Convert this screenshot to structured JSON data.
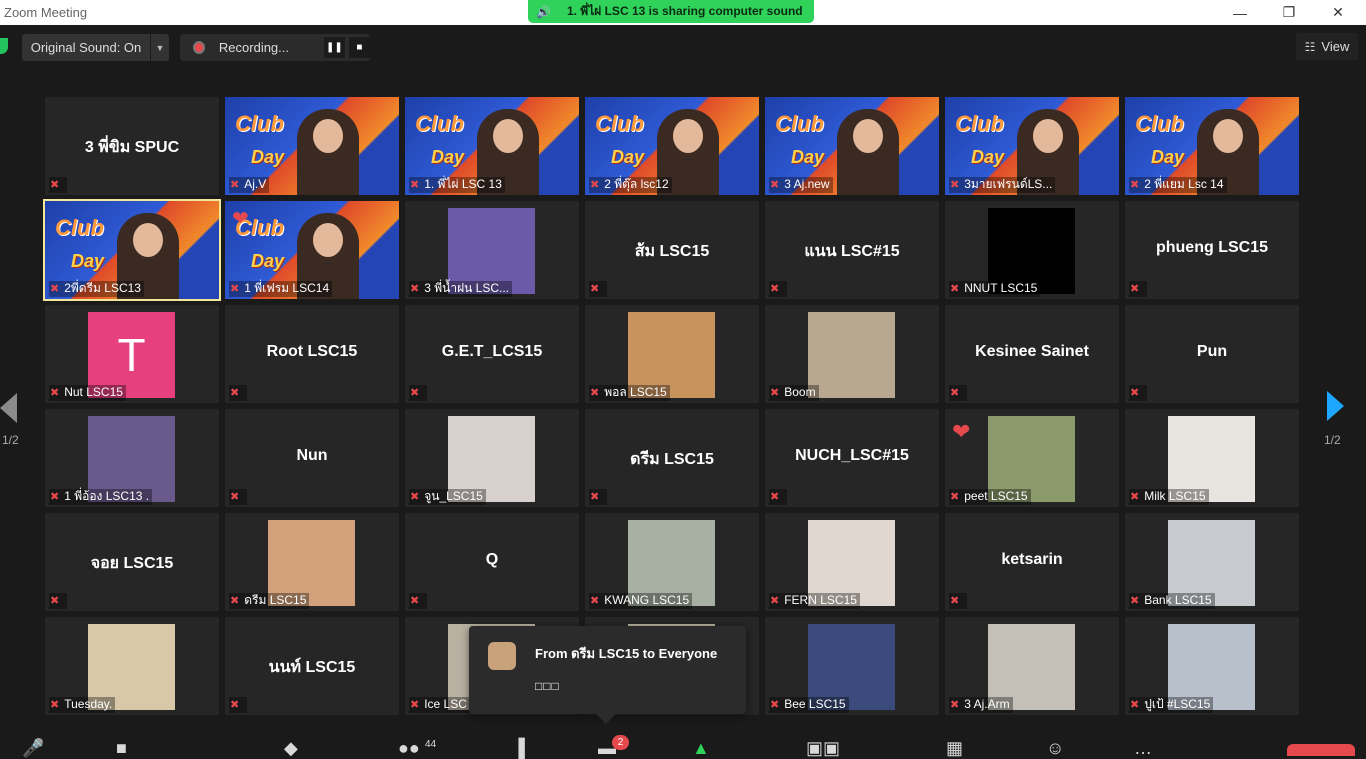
{
  "window": {
    "title": "Zoom Meeting",
    "minimize": "—",
    "restore": "❐",
    "close": "✕"
  },
  "banner": {
    "text": "1. พี่ไผ่ LSC 13 is sharing computer sound"
  },
  "topbar": {
    "original_sound": "Original Sound: On",
    "recording": "Recording...",
    "pause": "❚❚",
    "stop": "■",
    "view": "View"
  },
  "pagination": {
    "left": "1/2",
    "right": "1/2"
  },
  "tiles": [
    {
      "label": "",
      "name": "3 พี่ขิม SPUC",
      "kind": "name"
    },
    {
      "label": "Aj.V",
      "kind": "poster"
    },
    {
      "label": "1. พี่ไผ่ LSC 13",
      "kind": "poster"
    },
    {
      "label": "2 พี่ตุ๊ล lsc12",
      "kind": "poster"
    },
    {
      "label": "3 Aj.new",
      "kind": "poster"
    },
    {
      "label": "3มายเฟรนด์LS...",
      "kind": "poster"
    },
    {
      "label": "2 พี่แยม Lsc 14",
      "kind": "poster"
    },
    {
      "label": "2พี่ดรีม LSC13",
      "kind": "poster",
      "selected": true
    },
    {
      "label": "1 พี่เฟรม LSC14",
      "kind": "poster"
    },
    {
      "label": "3 พี่น้ำฝน LSC...",
      "kind": "photo",
      "color": "#6b5aa8"
    },
    {
      "label": "",
      "name": "ส้ม LSC15",
      "kind": "name"
    },
    {
      "label": "",
      "name": "แนน LSC#15",
      "kind": "name"
    },
    {
      "label": "NNUT LSC15",
      "kind": "photo",
      "color": "#000000"
    },
    {
      "label": "",
      "name": "phueng LSC15",
      "kind": "name"
    },
    {
      "label": "Nut LSC15",
      "kind": "avatar",
      "letter": "T",
      "color": "#e6407e"
    },
    {
      "label": "",
      "name": "Root LSC15",
      "kind": "name"
    },
    {
      "label": "",
      "name": "G.E.T_LCS15",
      "kind": "name"
    },
    {
      "label": "พอล LSC15",
      "kind": "photo",
      "color": "#c9935e"
    },
    {
      "label": "Boom",
      "kind": "photo",
      "color": "#b8a890"
    },
    {
      "label": "",
      "name": "Kesinee Sainet",
      "kind": "name"
    },
    {
      "label": "",
      "name": "Pun",
      "kind": "name"
    },
    {
      "label": "1 พี่อ้อง LSC13 .",
      "kind": "photo",
      "color": "#6a5a8c"
    },
    {
      "label": "",
      "name": "Nun",
      "kind": "name"
    },
    {
      "label": "จูน_LSC15",
      "kind": "photo",
      "color": "#d8d0cc"
    },
    {
      "label": "",
      "name": "ดรีม LSC15",
      "kind": "name"
    },
    {
      "label": "",
      "name": "NUCH_LSC#15",
      "kind": "name"
    },
    {
      "label": "peet LSC15",
      "kind": "photo",
      "color": "#8a9a6a"
    },
    {
      "label": "Milk LSC15",
      "kind": "photo",
      "color": "#e8e4e0"
    },
    {
      "label": "",
      "name": "จอย LSC15",
      "kind": "name"
    },
    {
      "label": "ดรีม LSC15",
      "kind": "photo",
      "color": "#d2a07a"
    },
    {
      "label": "",
      "name": "Q",
      "kind": "name"
    },
    {
      "label": "KWANG LSC15",
      "kind": "photo",
      "color": "#a8b0a4"
    },
    {
      "label": "FERN LSC15",
      "kind": "photo",
      "color": "#e0d8d0"
    },
    {
      "label": "",
      "name": "ketsarin",
      "kind": "name"
    },
    {
      "label": "Bank LSC15",
      "kind": "photo",
      "color": "#c8ccd0"
    },
    {
      "label": "Tuesday.",
      "kind": "photo",
      "color": "#d8c8a8"
    },
    {
      "label": "",
      "name": "นนท์ LSC15",
      "kind": "name"
    },
    {
      "label": "Ice LSC",
      "kind": "photo",
      "color": "#b8b0a0"
    },
    {
      "label": "",
      "kind": "photo",
      "color": "#b8b0a0"
    },
    {
      "label": "Bee LSC15",
      "kind": "photo",
      "color": "#3a4a7a"
    },
    {
      "label": "3 Aj.Arm",
      "kind": "photo",
      "color": "#c4c0b8"
    },
    {
      "label": "ปูเป้ #LSC15",
      "kind": "photo",
      "color": "#b8c0cc"
    }
  ],
  "chat": {
    "from": "From ดรีม LSC15 to Everyone",
    "message": "□□□"
  },
  "toolbar": {
    "participants_count": "44",
    "chat_badge": "2"
  },
  "colors": {
    "accent": "#2fd35a",
    "mute": "#e5484d",
    "selected_outline": "#f2e79a",
    "next_arrow": "#1ea7ff"
  }
}
